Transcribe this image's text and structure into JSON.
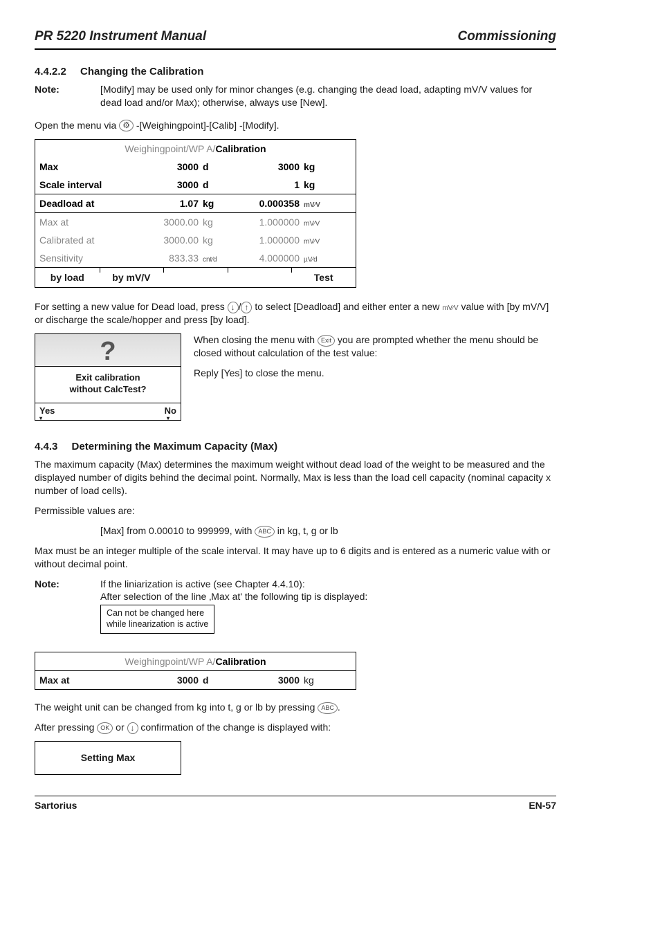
{
  "header": {
    "left": "PR 5220 Instrument Manual",
    "right": "Commissioning"
  },
  "s1": {
    "num": "4.4.2.2",
    "title": "Changing the Calibration",
    "note_label": "Note:",
    "note_body": "[Modify] may be used only for minor changes (e.g. changing the dead load, adapting mV/V values for dead load and/or Max); otherwise, always use [New].",
    "open_line_pre": "Open the menu via ",
    "open_line_post": "-[Weighingpoint]-[Calib] -[Modify]."
  },
  "cal": {
    "title_grey": "Weighingpoint/WP A/",
    "title_bold": "Calibration",
    "rows": [
      {
        "label": "Max",
        "v1": "3000",
        "u1": "d",
        "v2": "3000",
        "u2": "kg",
        "bold": true
      },
      {
        "label": "Scale interval",
        "v1": "3000",
        "u1": "d",
        "v2": "1",
        "u2": "kg",
        "bold": true
      },
      {
        "label": "Deadload at",
        "v1": "1.07",
        "u1": "kg",
        "v2": "0.000358",
        "u2": "mV/V",
        "bold": true,
        "sep": true
      },
      {
        "label": "Max at",
        "v1": "3000.00",
        "u1": "kg",
        "v2": "1.000000",
        "u2": "mV/V",
        "grey": true,
        "sep": true
      },
      {
        "label": "Calibrated at",
        "v1": "3000.00",
        "u1": "kg",
        "v2": "1.000000",
        "u2": "mV/V",
        "grey": true
      },
      {
        "label": "Sensitivity",
        "v1": "833.33",
        "u1": "cnt/d",
        "v2": "4.000000",
        "u2": "µV/d",
        "grey": true
      }
    ],
    "footer": [
      "by load",
      "by mV/V",
      "",
      "",
      "Test"
    ]
  },
  "after_table": {
    "p1a": "For setting a new value for Dead load, press ",
    "p1b": " to select [Deadload] and either enter a new ",
    "p1c": " value with [by mV/V] or discharge the scale/hopper and press [by load]."
  },
  "prompt": {
    "line1": "Exit calibration",
    "line2": "without CalcTest?",
    "yes": "Yes",
    "no": "No",
    "side1a": "When closing the menu with ",
    "side1b": " you are prompted whether the menu should be closed without calculation of the test value:",
    "side2": "Reply [Yes] to close the menu."
  },
  "s2": {
    "num": "4.4.3",
    "title": "Determining the Maximum Capacity (Max)",
    "p1": "The maximum capacity (Max) determines the maximum weight without dead load of the weight to be measured and the displayed number of digits behind the decimal point. Normally, Max is less than the load cell capacity (nominal capacity x number of load cells).",
    "p2": "Permissible values are:",
    "p3a": "[Max] from 0.00010 to 999999, with ",
    "p3b": " in kg, t, g or lb",
    "p4": "Max must be an integer multiple of the scale interval. It may have up to 6 digits and is entered as a numeric value with or without decimal point.",
    "note_label": "Note:",
    "note_l1": "If the liniarization is active (see Chapter 4.4.10):",
    "note_l2": "After selection of the line ‚Max at' the following tip is displayed:",
    "tip_l1": "Can not be changed here",
    "tip_l2": "while linearization is active"
  },
  "maxbox": {
    "title_grey": "Weighingpoint/WP A/",
    "title_bold": "Calibration",
    "label": "Max at",
    "v1": "3000",
    "u1": "d",
    "v2": "3000",
    "u2": "kg"
  },
  "tail": {
    "p1a": "The weight unit can be changed from kg into t, g or lb by pressing ",
    "p1b": ".",
    "p2a": "After pressing ",
    "p2b": " or ",
    "p2c": " confirmation of the change is displayed with:",
    "box": "Setting Max"
  },
  "footer": {
    "left": "Sartorius",
    "right": "EN-57"
  },
  "icons": {
    "setup": "⚙",
    "down": "↓",
    "up": "↑",
    "exit": "Exit",
    "abc": "ABC",
    "ok": "OK",
    "mvv": "mV⁄V",
    "uvd": "µV⁄d",
    "cntd": "cnt⁄d"
  }
}
